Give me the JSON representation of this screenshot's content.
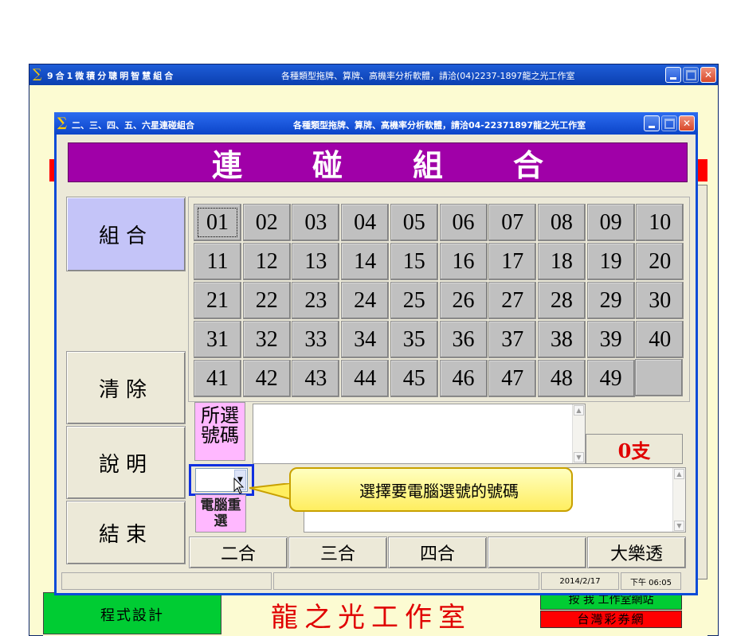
{
  "outer_window": {
    "title_left": "9合1微積分聰明智慧組合",
    "title_right": "各種類型拖牌、算牌、高機率分析軟體，請洽(04)2237-1897龍之光工作室",
    "bottom": {
      "program_label": "程式設計",
      "studio_name": "龍之光工作室",
      "link_green": "按 我 工作室網站",
      "link_red": "台灣彩券網"
    }
  },
  "inner_window": {
    "title_left": "二、三、四、五、六星連碰組合",
    "title_right": "各種類型拖牌、算牌、高機率分析軟體，請洽04-22371897龍之光工作室",
    "header": [
      "連",
      "碰",
      "組",
      "合"
    ],
    "side_buttons": {
      "combine": "組合",
      "clear": "清除",
      "help": "說明",
      "exit": "結束"
    },
    "numbers": [
      "01",
      "02",
      "03",
      "04",
      "05",
      "06",
      "07",
      "08",
      "09",
      "10",
      "11",
      "12",
      "13",
      "14",
      "15",
      "16",
      "17",
      "18",
      "19",
      "20",
      "21",
      "22",
      "23",
      "24",
      "25",
      "26",
      "27",
      "28",
      "29",
      "30",
      "31",
      "32",
      "33",
      "34",
      "35",
      "36",
      "37",
      "38",
      "39",
      "40",
      "41",
      "42",
      "43",
      "44",
      "45",
      "46",
      "47",
      "48",
      "49"
    ],
    "selected_label": "所選號碼",
    "selected_count": "0支",
    "reselect_label": "電腦重選",
    "tooltip": "選擇要電腦選號的號碼",
    "bottom_buttons": {
      "two": "二合",
      "three": "三合",
      "four": "四合",
      "lotto": "大樂透"
    },
    "status": {
      "date": "2014/2/17",
      "time": "下午 06:05"
    }
  },
  "colors": {
    "title_bar": "#0b44c8",
    "header_band": "#a000a8",
    "active_side": "#c4c4f8",
    "pink_label": "#ffb8ff",
    "count_text": "#e00000",
    "tooltip": "#ffee60"
  }
}
